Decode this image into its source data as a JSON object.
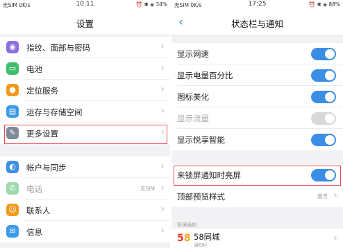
{
  "left": {
    "status": {
      "carrier": "无SIM 0K/s",
      "time": "10:11",
      "indicators": "⏰ ✱ ◈ 34%"
    },
    "title": "设置",
    "items": [
      {
        "label": "指纹、面部与密码",
        "icon": "fingerprint-icon",
        "glyph": "◉",
        "color": "#8b6fe0"
      },
      {
        "label": "电池",
        "icon": "battery-icon",
        "glyph": "▭",
        "color": "#3fbf6a"
      },
      {
        "label": "定位服务",
        "icon": "location-icon",
        "glyph": "●",
        "color": "#f29a1e"
      },
      {
        "label": "运存与存储空间",
        "icon": "storage-icon",
        "glyph": "▤",
        "color": "#3d9be9"
      },
      {
        "label": "更多设置",
        "icon": "wrench-icon",
        "glyph": "✎",
        "color": "#7e8b98"
      },
      {
        "label": "帐户与同步",
        "icon": "account-sync-icon",
        "glyph": "◐",
        "color": "#3d8fe8"
      },
      {
        "label": "电话",
        "icon": "phone-icon",
        "glyph": "✆",
        "color": "#9fd9ae",
        "aux": "无SIM",
        "dim": true
      },
      {
        "label": "联系人",
        "icon": "contacts-icon",
        "glyph": "☺",
        "color": "#f29a1e"
      },
      {
        "label": "信息",
        "icon": "messages-icon",
        "glyph": "✉",
        "color": "#3d9be9"
      }
    ]
  },
  "right": {
    "status": {
      "carrier": "无SIM 0K/s",
      "time": "17:25",
      "indicators": "⏰ ✱ ◈ 88%"
    },
    "title": "状态栏与通知",
    "toggles": [
      {
        "label": "显示网速",
        "on": true
      },
      {
        "label": "显示电量百分比",
        "on": true
      },
      {
        "label": "图标美化",
        "on": true
      },
      {
        "label": "显示流量",
        "on": false,
        "disabled": true
      },
      {
        "label": "显示悦享智能",
        "on": true
      }
    ],
    "lockscreen": {
      "label": "来锁屏通知时亮屏",
      "on": true
    },
    "preview": {
      "label": "顶部预览样式",
      "value": "悬浮"
    },
    "section_caption": "管理通知",
    "app": {
      "name": "58同城",
      "sub": "通知栏",
      "logo": "58"
    },
    "colors": {
      "accent": "#3a8ee6",
      "highlight": "#e0474c"
    }
  }
}
